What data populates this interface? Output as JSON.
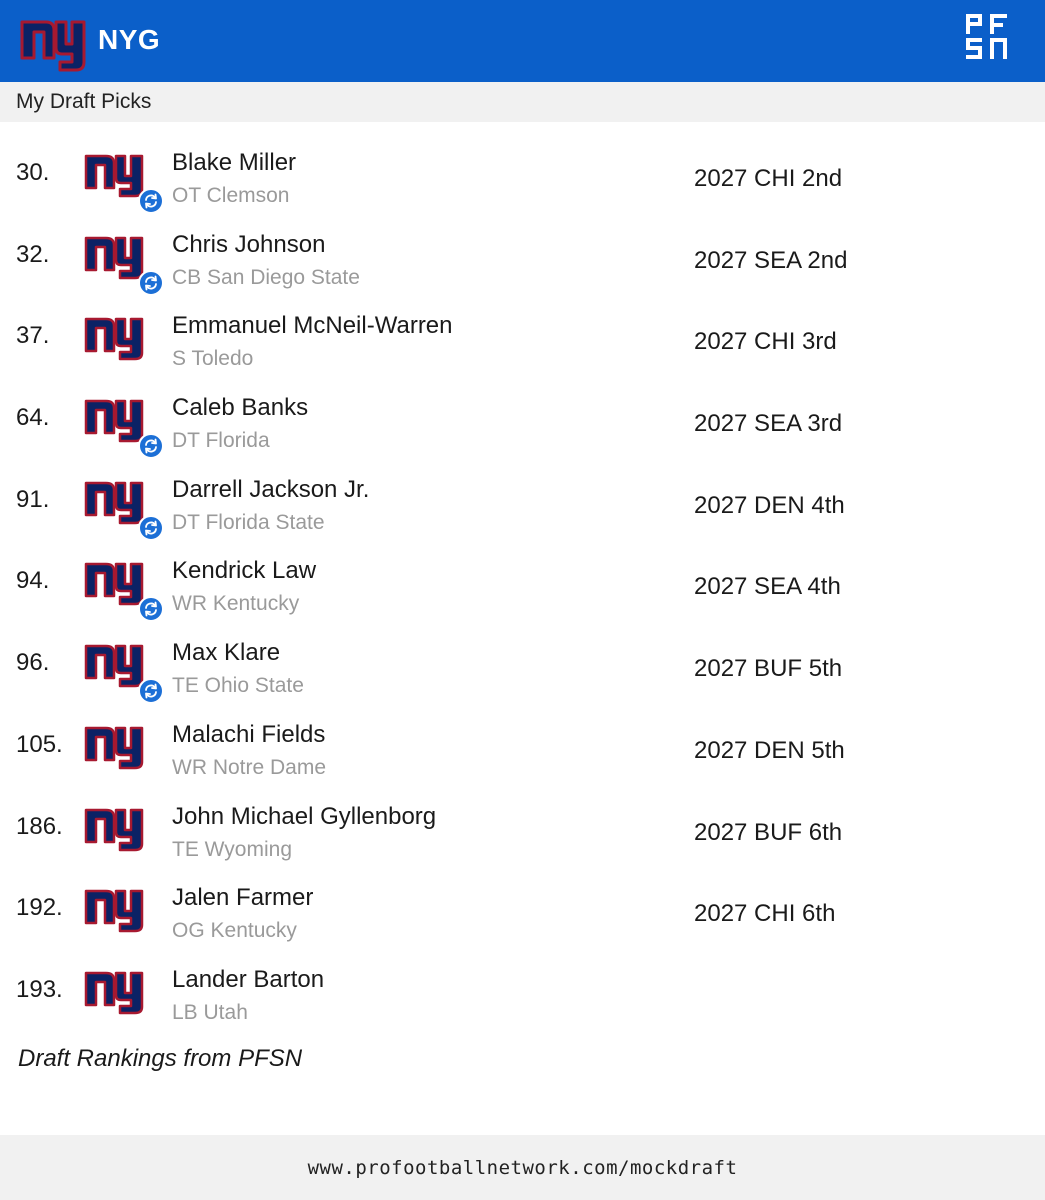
{
  "header": {
    "team_code": "NYG",
    "team_logo_icon": "ny-giants-logo",
    "brand_logo_icon": "pfsn-logo",
    "bar_color": "#0b5fc9"
  },
  "subheader": {
    "title": "My Draft Picks"
  },
  "picks": [
    {
      "number": "30.",
      "name": "Blake Miller",
      "meta": "OT Clemson",
      "trade": "2027 CHI 2nd",
      "traded": true
    },
    {
      "number": "32.",
      "name": "Chris Johnson",
      "meta": "CB San Diego State",
      "trade": "2027 SEA 2nd",
      "traded": true
    },
    {
      "number": "37.",
      "name": "Emmanuel McNeil-Warren",
      "meta": "S Toledo",
      "trade": "2027 CHI 3rd",
      "traded": false
    },
    {
      "number": "64.",
      "name": "Caleb Banks",
      "meta": "DT Florida",
      "trade": "2027 SEA 3rd",
      "traded": true
    },
    {
      "number": "91.",
      "name": "Darrell Jackson Jr.",
      "meta": "DT Florida State",
      "trade": "2027 DEN 4th",
      "traded": true
    },
    {
      "number": "94.",
      "name": "Kendrick Law",
      "meta": "WR Kentucky",
      "trade": "2027 SEA 4th",
      "traded": true
    },
    {
      "number": "96.",
      "name": "Max Klare",
      "meta": "TE Ohio State",
      "trade": "2027 BUF 5th",
      "traded": true
    },
    {
      "number": "105.",
      "name": "Malachi Fields",
      "meta": "WR Notre Dame",
      "trade": "2027 DEN 5th",
      "traded": false
    },
    {
      "number": "186.",
      "name": "John Michael Gyllenborg",
      "meta": "TE Wyoming",
      "trade": "2027 BUF 6th",
      "traded": false
    },
    {
      "number": "192.",
      "name": "Jalen Farmer",
      "meta": "OG Kentucky",
      "trade": "2027 CHI 6th",
      "traded": false
    },
    {
      "number": "193.",
      "name": "Lander Barton",
      "meta": "LB Utah",
      "trade": "",
      "traded": false
    }
  ],
  "credit": "Draft Rankings from PFSN",
  "footer": {
    "url": "www.profootballnetwork.com/mockdraft"
  },
  "colors": {
    "giants_blue": "#0b2265",
    "giants_red": "#a71930",
    "trade_badge": "#1c6fd6"
  }
}
